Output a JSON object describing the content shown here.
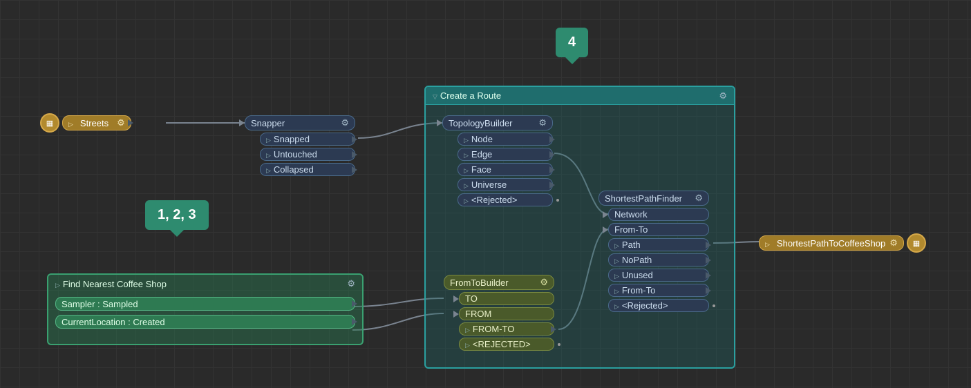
{
  "callouts": {
    "left": "1, 2, 3",
    "right": "4"
  },
  "source": {
    "streets": "Streets"
  },
  "sink": {
    "result": "ShortestPathToCoffeeShop"
  },
  "nodes": {
    "snapper": {
      "title": "Snapper",
      "ports": [
        "Snapped",
        "Untouched",
        "Collapsed"
      ]
    },
    "topology": {
      "title": "TopologyBuilder",
      "ports": [
        "Node",
        "Edge",
        "Face",
        "Universe",
        "<Rejected>"
      ]
    },
    "fromto": {
      "title": "FromToBuilder",
      "inputs": [
        "TO",
        "FROM"
      ],
      "outputs": [
        "FROM-TO",
        "<REJECTED>"
      ]
    },
    "spf": {
      "title": "ShortestPathFinder",
      "inputs": [
        "Network",
        "From-To"
      ],
      "outputs": [
        "Path",
        "NoPath",
        "Unused",
        "From-To",
        "<Rejected>"
      ]
    }
  },
  "groups": {
    "route": "Create a Route",
    "coffee": "Find Nearest Coffee Shop"
  },
  "coffee_rows": [
    "Sampler : Sampled",
    "CurrentLocation : Created"
  ]
}
